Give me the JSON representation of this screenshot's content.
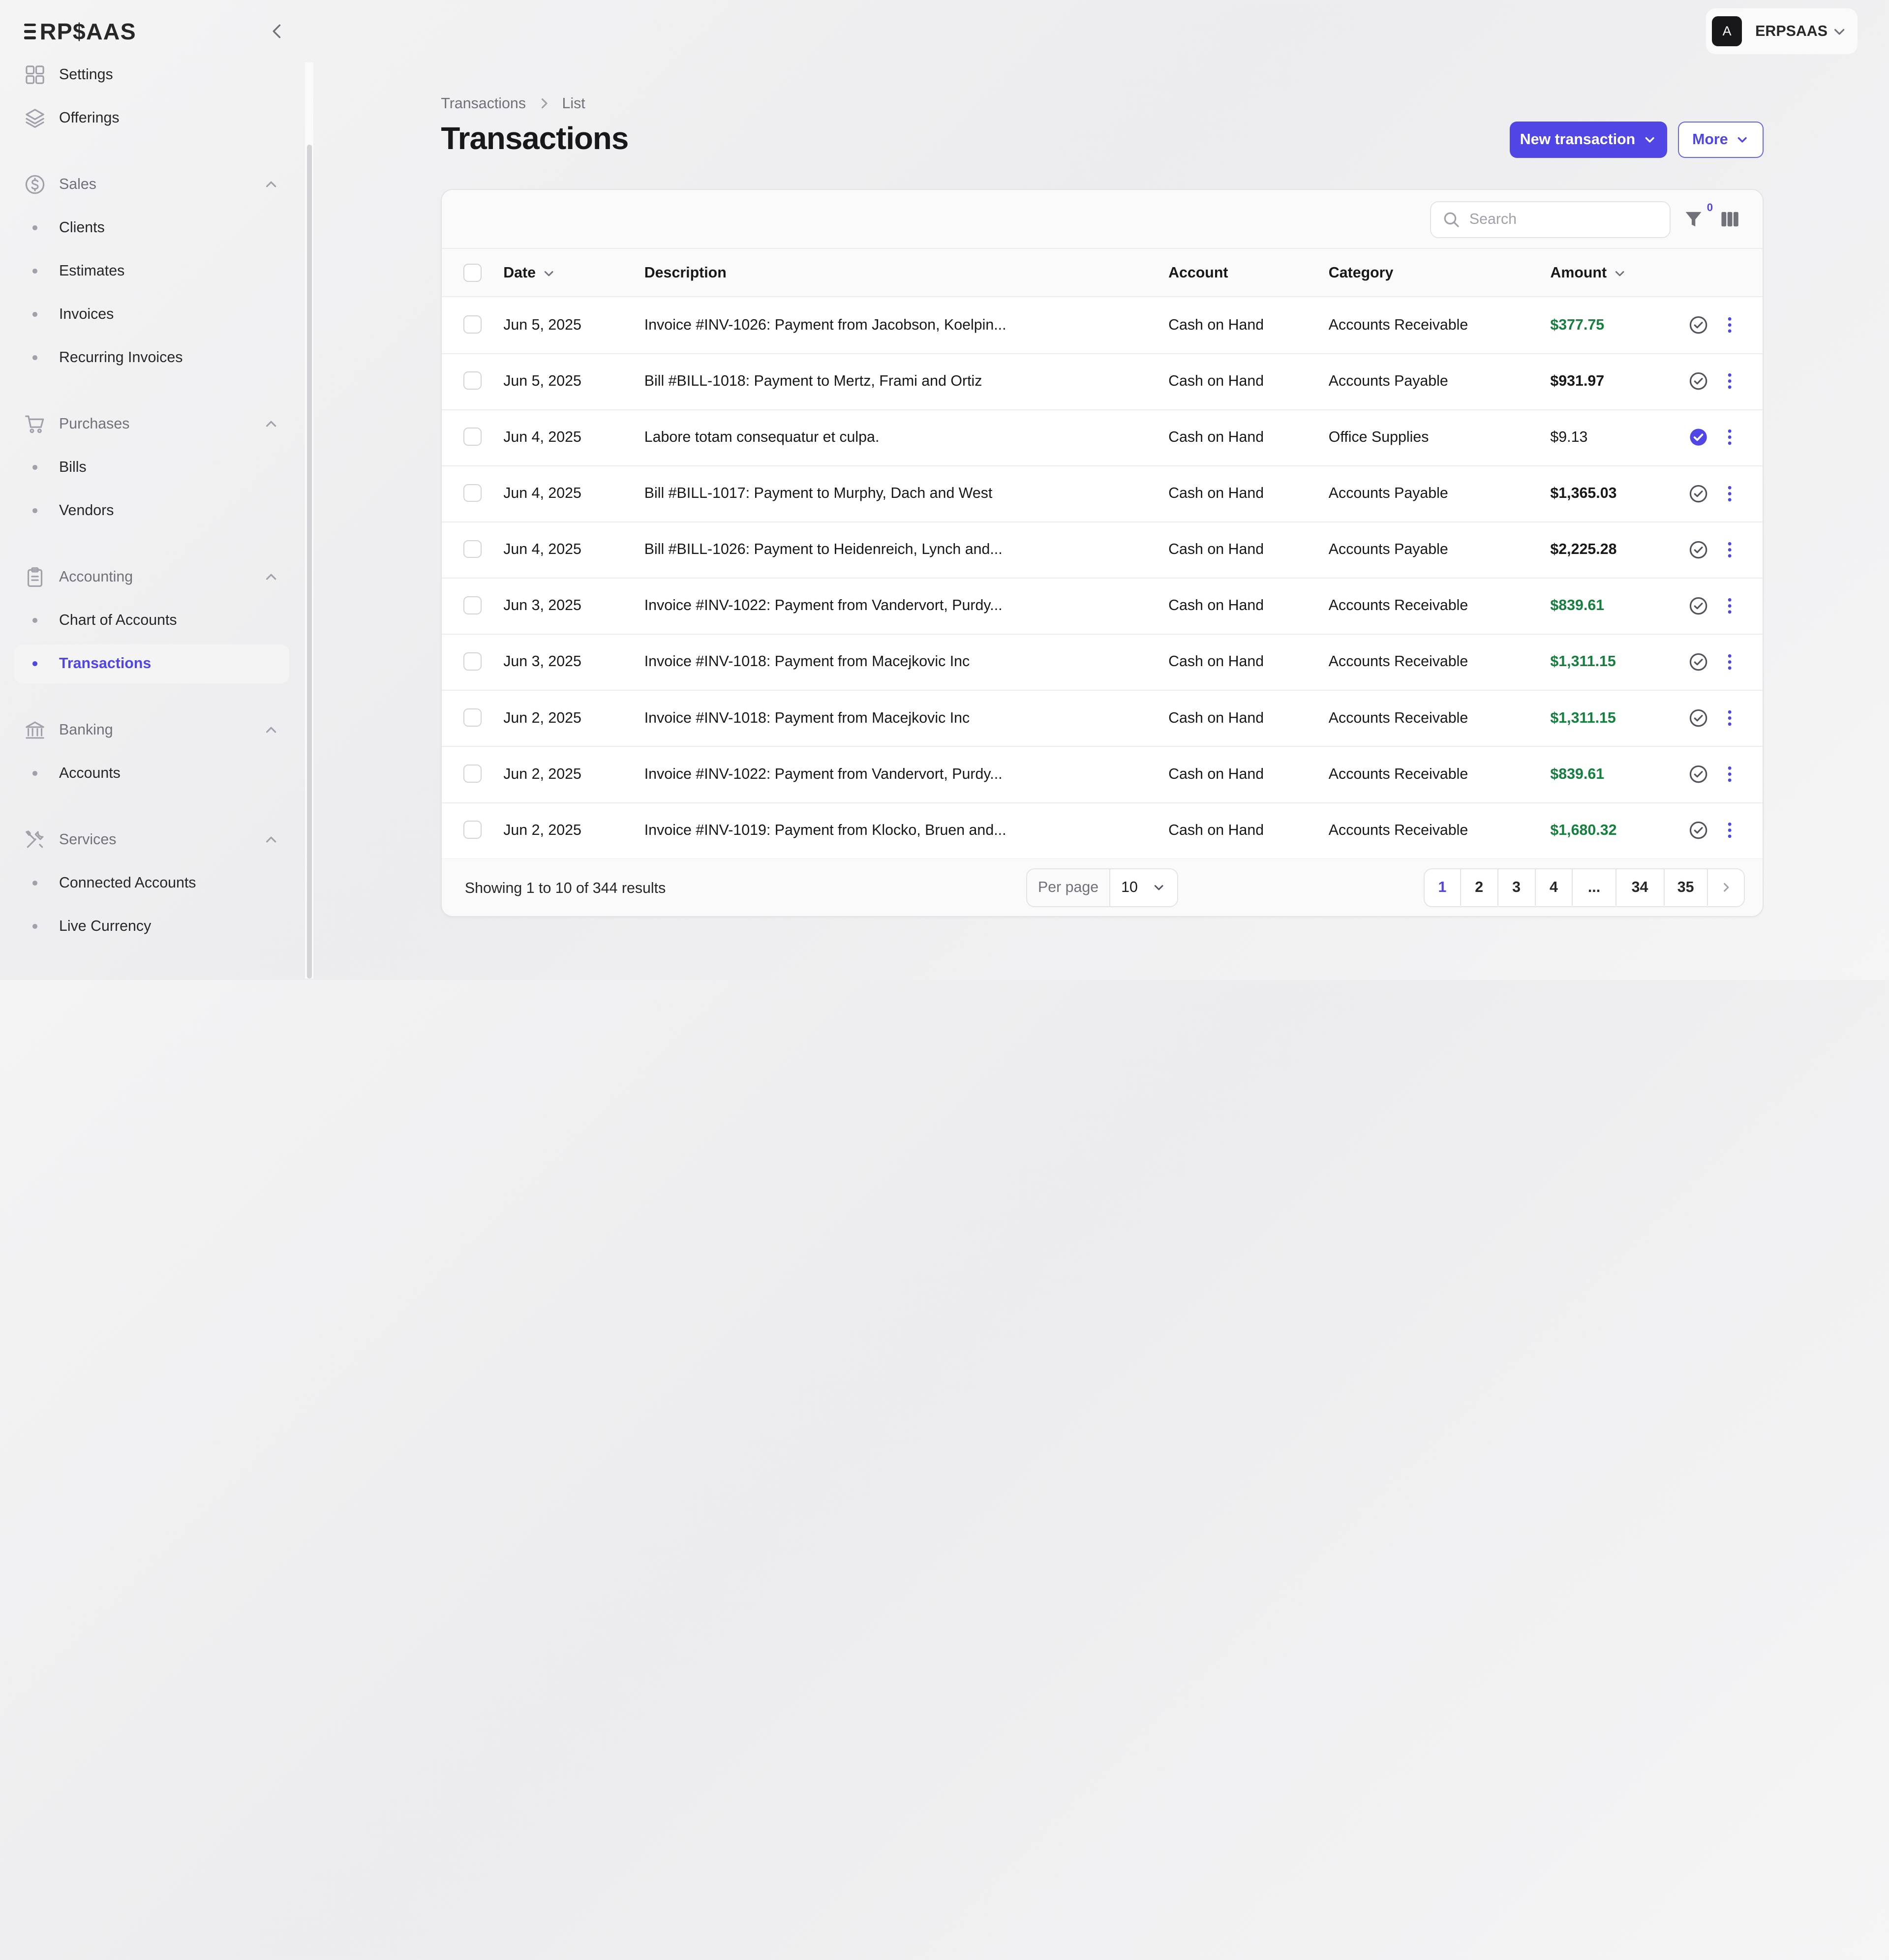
{
  "app": {
    "logo": "RP$AAS"
  },
  "sidebar": {
    "top_items": [
      {
        "label": "Settings",
        "icon": "grid-icon"
      },
      {
        "label": "Offerings",
        "icon": "layers-icon"
      }
    ],
    "groups": [
      {
        "label": "Sales",
        "icon": "dollar-circle-icon",
        "items": [
          "Clients",
          "Estimates",
          "Invoices",
          "Recurring Invoices"
        ]
      },
      {
        "label": "Purchases",
        "icon": "cart-icon",
        "items": [
          "Bills",
          "Vendors"
        ]
      },
      {
        "label": "Accounting",
        "icon": "clipboard-icon",
        "items": [
          "Chart of Accounts",
          "Transactions"
        ]
      },
      {
        "label": "Banking",
        "icon": "bank-icon",
        "items": [
          "Accounts"
        ]
      },
      {
        "label": "Services",
        "icon": "tools-icon",
        "items": [
          "Connected Accounts",
          "Live Currency"
        ]
      }
    ],
    "active_item": "Transactions"
  },
  "account": {
    "avatar_letter": "A",
    "name": "ERPSAAS"
  },
  "breadcrumb": {
    "root": "Transactions",
    "current": "List"
  },
  "page": {
    "title": "Transactions"
  },
  "actions": {
    "new_transaction": "New transaction",
    "more": "More"
  },
  "toolbar": {
    "search_placeholder": "Search",
    "filter_count": "0"
  },
  "table": {
    "headers": {
      "date": "Date",
      "description": "Description",
      "account": "Account",
      "category": "Category",
      "amount": "Amount"
    },
    "rows": [
      {
        "date": "Jun 5, 2025",
        "description": "Invoice #INV-1026: Payment from Jacobson, Koelpin...",
        "account": "Cash on Hand",
        "category": "Accounts Receivable",
        "amount": "$377.75",
        "amount_style": "green",
        "reviewed": false
      },
      {
        "date": "Jun 5, 2025",
        "description": "Bill #BILL-1018: Payment to Mertz, Frami and Ortiz",
        "account": "Cash on Hand",
        "category": "Accounts Payable",
        "amount": "$931.97",
        "amount_style": "bold",
        "reviewed": false
      },
      {
        "date": "Jun 4, 2025",
        "description": "Labore totam consequatur et culpa.",
        "account": "Cash on Hand",
        "category": "Office Supplies",
        "amount": "$9.13",
        "amount_style": "plain",
        "reviewed": true
      },
      {
        "date": "Jun 4, 2025",
        "description": "Bill #BILL-1017: Payment to Murphy, Dach and West",
        "account": "Cash on Hand",
        "category": "Accounts Payable",
        "amount": "$1,365.03",
        "amount_style": "bold",
        "reviewed": false
      },
      {
        "date": "Jun 4, 2025",
        "description": "Bill #BILL-1026: Payment to Heidenreich, Lynch and...",
        "account": "Cash on Hand",
        "category": "Accounts Payable",
        "amount": "$2,225.28",
        "amount_style": "bold",
        "reviewed": false
      },
      {
        "date": "Jun 3, 2025",
        "description": "Invoice #INV-1022: Payment from Vandervort, Purdy...",
        "account": "Cash on Hand",
        "category": "Accounts Receivable",
        "amount": "$839.61",
        "amount_style": "green",
        "reviewed": false
      },
      {
        "date": "Jun 3, 2025",
        "description": "Invoice #INV-1018: Payment from Macejkovic Inc",
        "account": "Cash on Hand",
        "category": "Accounts Receivable",
        "amount": "$1,311.15",
        "amount_style": "green",
        "reviewed": false
      },
      {
        "date": "Jun 2, 2025",
        "description": "Invoice #INV-1018: Payment from Macejkovic Inc",
        "account": "Cash on Hand",
        "category": "Accounts Receivable",
        "amount": "$1,311.15",
        "amount_style": "green",
        "reviewed": false
      },
      {
        "date": "Jun 2, 2025",
        "description": "Invoice #INV-1022: Payment from Vandervort, Purdy...",
        "account": "Cash on Hand",
        "category": "Accounts Receivable",
        "amount": "$839.61",
        "amount_style": "green",
        "reviewed": false
      },
      {
        "date": "Jun 2, 2025",
        "description": "Invoice #INV-1019: Payment from Klocko, Bruen and...",
        "account": "Cash on Hand",
        "category": "Accounts Receivable",
        "amount": "$1,680.32",
        "amount_style": "green",
        "reviewed": false
      }
    ]
  },
  "footer": {
    "results_text": "Showing 1 to 10 of 344 results",
    "per_page_label": "Per page",
    "per_page_value": "10",
    "pages": [
      "1",
      "2",
      "3",
      "4",
      "...",
      "34",
      "35"
    ],
    "current_page": "1"
  },
  "colors": {
    "accent": "#4f46e5",
    "positive": "#15803d",
    "sidebar_active_bg": "#f4f4f5"
  }
}
